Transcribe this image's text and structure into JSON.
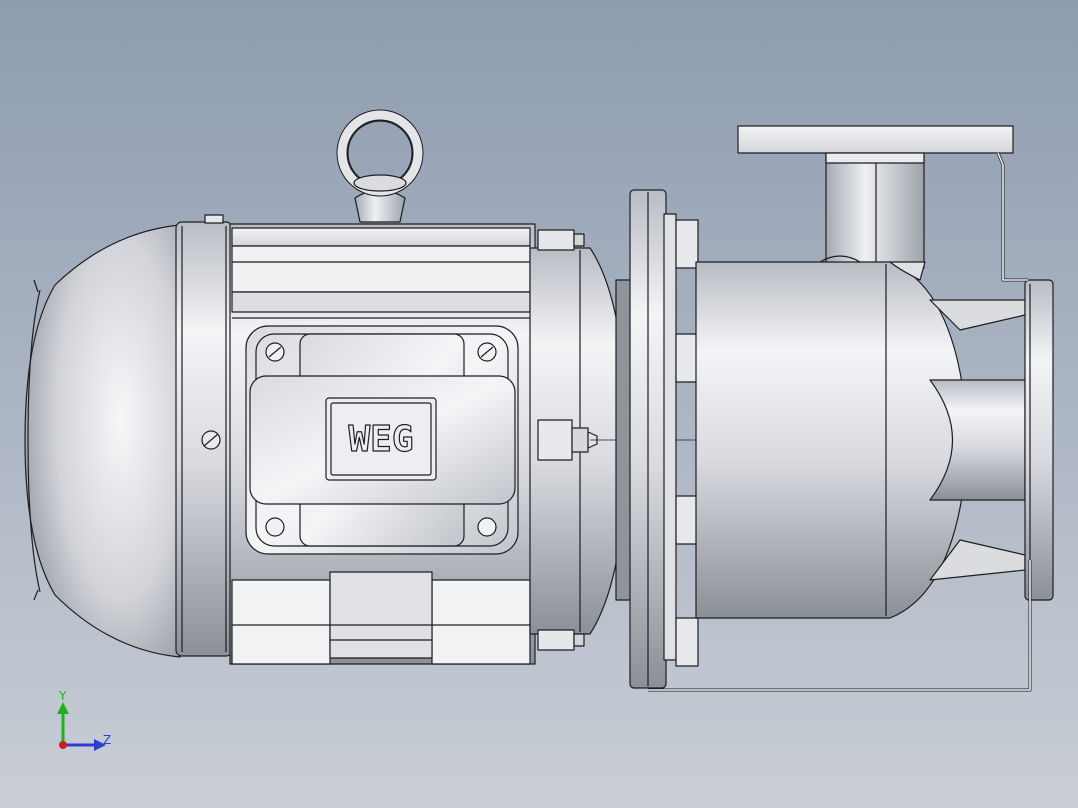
{
  "viewport": {
    "background_top": "#8e9cb0",
    "background_bottom": "#c9ced6"
  },
  "model": {
    "logo_text": "WEG",
    "metal_light": "#f4f5f7",
    "metal_mid": "#c4c7cd",
    "metal_dark": "#7c8088",
    "edge_color": "#1e1e22"
  },
  "triad": {
    "y_label": "Y",
    "z_label": "Z",
    "y_color": "#1db21d",
    "z_color": "#2a3fd0",
    "x_color": "#d01e1e"
  }
}
